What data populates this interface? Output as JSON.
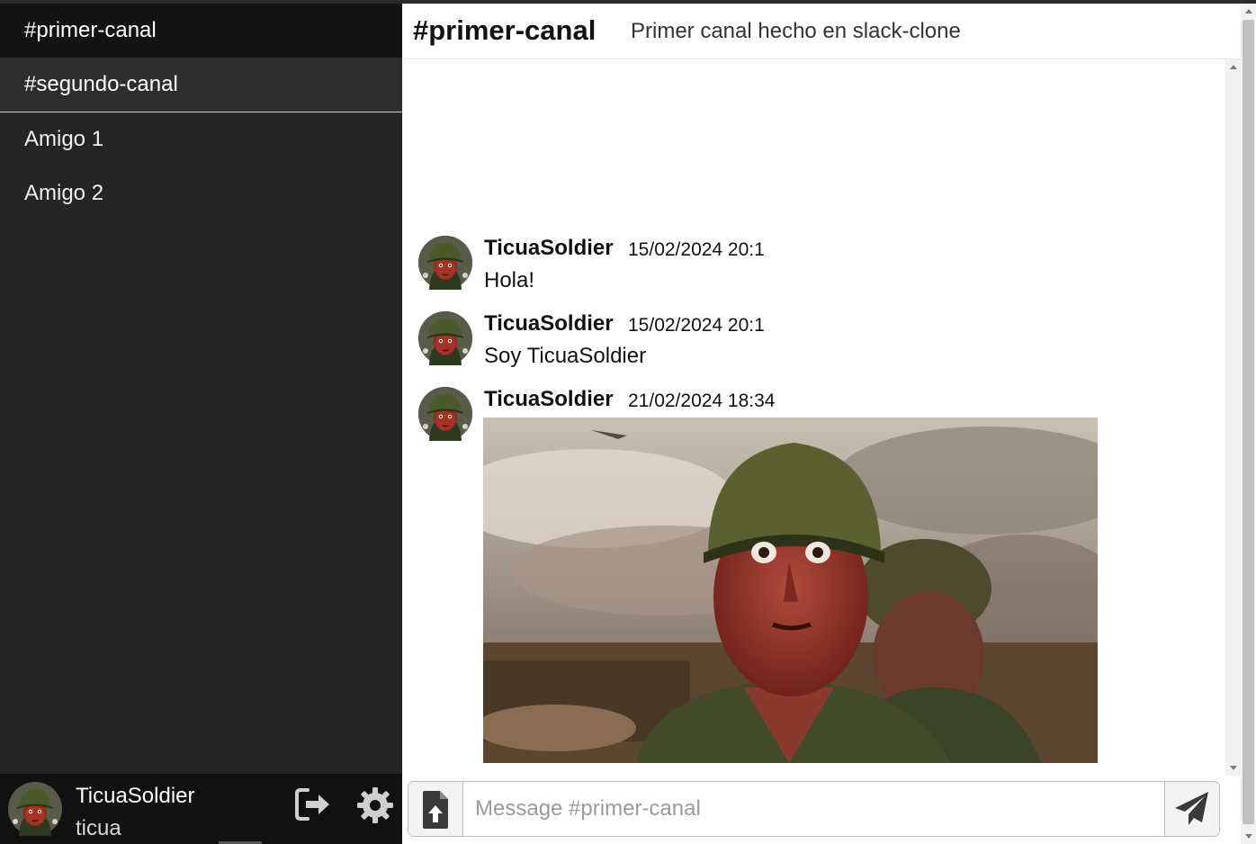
{
  "sidebar": {
    "channels": [
      {
        "label": "#primer-canal",
        "active": true
      },
      {
        "label": "#segundo-canal",
        "active": false
      }
    ],
    "friends": [
      {
        "label": "Amigo 1"
      },
      {
        "label": "Amigo 2"
      }
    ],
    "user": {
      "display_name": "TicuaSoldier",
      "handle": "ticua",
      "avatar_icon": "soldier-avatar",
      "logout_icon": "logout-icon",
      "settings_icon": "gear-icon"
    }
  },
  "header": {
    "channel_title": "#primer-canal",
    "channel_description": "Primer canal hecho en slack-clone"
  },
  "messages": [
    {
      "author": "TicuaSoldier",
      "time": "15/02/2024 20:1",
      "text": "Hola!"
    },
    {
      "author": "TicuaSoldier",
      "time": "15/02/2024 20:1",
      "text": "Soy TicuaSoldier"
    },
    {
      "author": "TicuaSoldier",
      "time": "21/02/2024 18:34",
      "image": "soldier-painting-image"
    }
  ],
  "composer": {
    "placeholder": "Message #primer-canal",
    "value": "",
    "attach_icon": "file-upload-icon",
    "send_icon": "paper-plane-icon"
  },
  "colors": {
    "sidebar_bg": "#252525",
    "active_channel_bg": "#131313",
    "user_panel_bg": "#111111",
    "text_light": "#ffffff"
  }
}
